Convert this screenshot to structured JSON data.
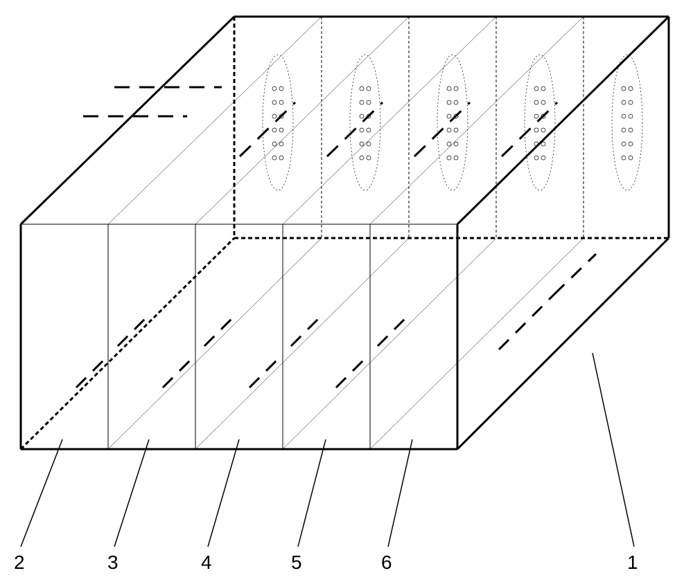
{
  "labels": {
    "l1": "1",
    "l2": "2",
    "l3": "3",
    "l4": "4",
    "l5": "5",
    "l6": "6"
  },
  "diagram": {
    "type": "3d-box-schematic",
    "description": "Isometric wireframe box with internal partitions, dashed lines, and dotted ellipses",
    "partitions": 5,
    "ellipses_count": 5
  }
}
